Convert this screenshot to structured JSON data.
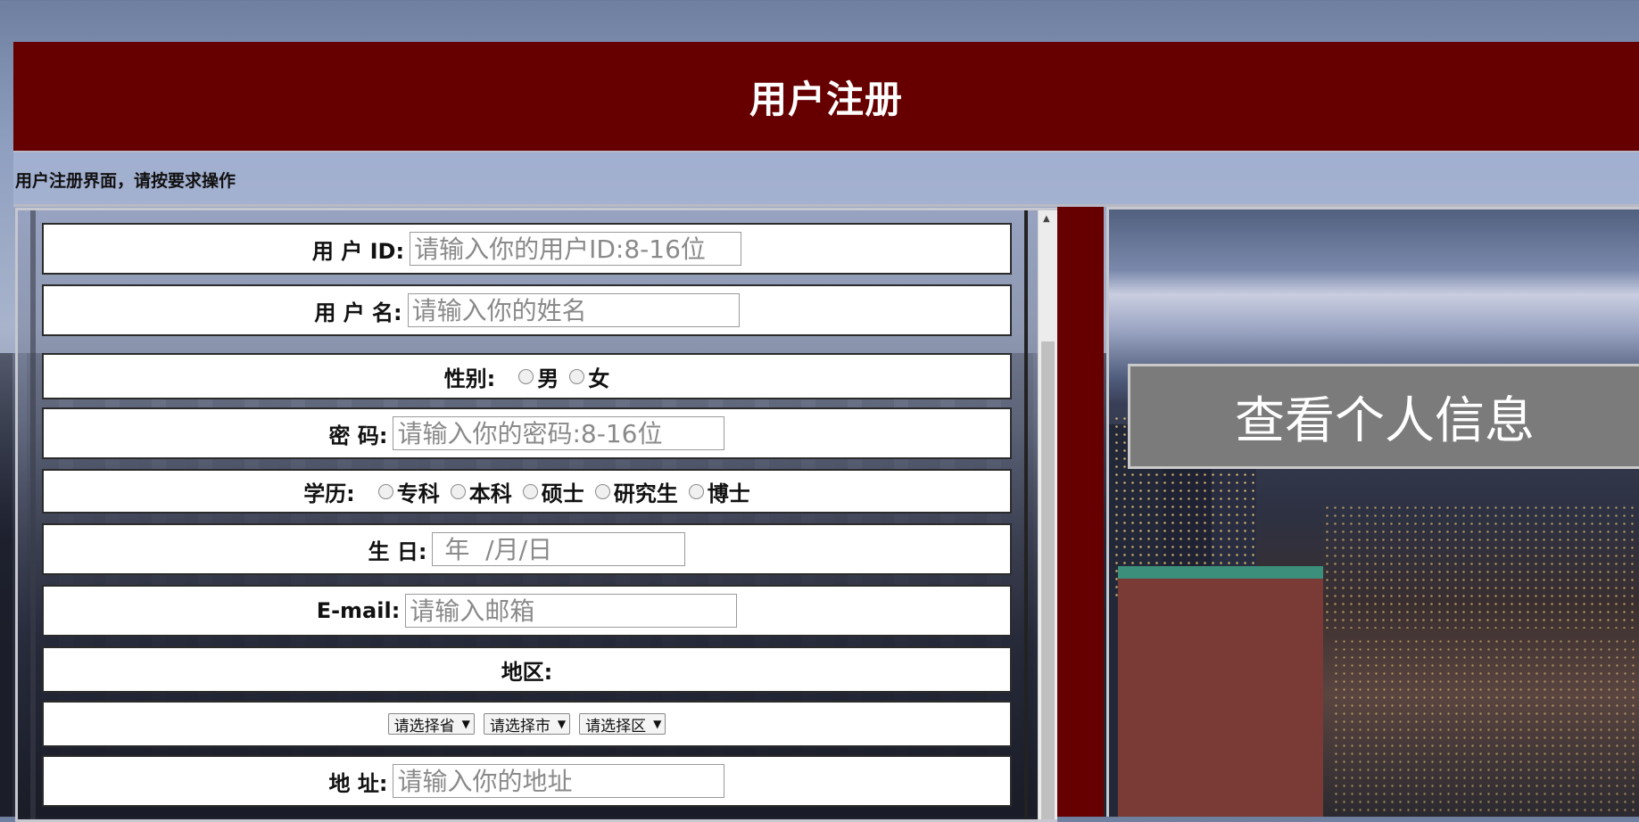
{
  "header": {
    "title": "用户注册"
  },
  "subbar": {
    "text": "用户注册界面，请按要求操作"
  },
  "form": {
    "user_id": {
      "label": "用 户 ID:",
      "placeholder": "请输入你的用户ID:8-16位"
    },
    "username": {
      "label": "用 户 名:",
      "placeholder": "请输入你的姓名"
    },
    "gender": {
      "label": "性别:",
      "options": [
        "男",
        "女"
      ]
    },
    "password": {
      "label": "密 码:",
      "placeholder": "请输入你的密码:8-16位"
    },
    "education": {
      "label": "学历:",
      "options": [
        "专科",
        "本科",
        "硕士",
        "研究生",
        "博士"
      ]
    },
    "birthday": {
      "label": "生 日:",
      "placeholder": " 年  /月/日"
    },
    "email": {
      "label": "E-mail:",
      "placeholder": "请输入邮箱"
    },
    "region": {
      "label": "地区:",
      "province": "请选择省",
      "city": "请选择市",
      "district": "请选择区"
    },
    "address": {
      "label": "地 址:",
      "placeholder": "请输入你的地址"
    }
  },
  "side": {
    "view_info_label": "查看个人信息"
  }
}
